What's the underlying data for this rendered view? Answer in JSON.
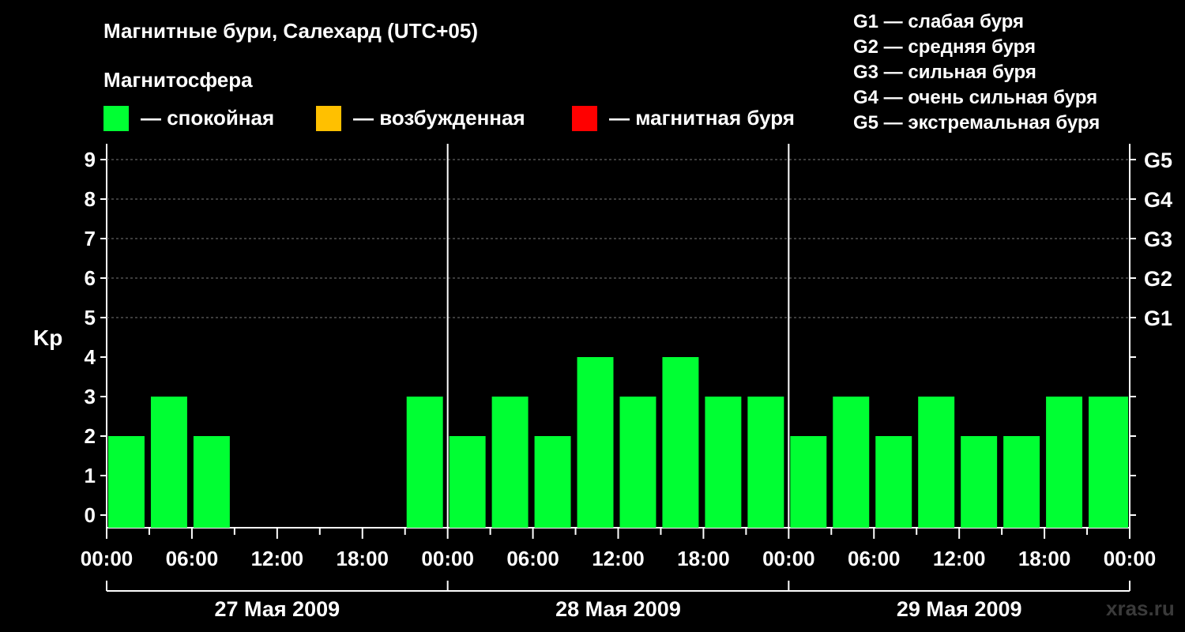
{
  "header": {
    "title": "Магнитные бури, Салехард (UTC+05)",
    "subtitle": "Магнитосфера",
    "watermark": "xras.ru"
  },
  "legend": [
    {
      "label": "— спокойная",
      "color": "#00ff33"
    },
    {
      "label": "— возбужденная",
      "color": "#ffc000"
    },
    {
      "label": "— магнитная буря",
      "color": "#ff0000"
    }
  ],
  "g_scale": [
    "G1 — слабая буря",
    "G2 — средняя буря",
    "G3 — сильная буря",
    "G4 — очень сильная буря",
    "G5 — экстремальная буря"
  ],
  "chart_data": {
    "type": "bar",
    "ylabel": "Kp",
    "ylim": [
      0,
      9
    ],
    "y_ticks": [
      "0",
      "1",
      "2",
      "3",
      "4",
      "5",
      "6",
      "7",
      "8",
      "9"
    ],
    "right_ticks": [
      {
        "y": 5,
        "label": "G1"
      },
      {
        "y": 6,
        "label": "G2"
      },
      {
        "y": 7,
        "label": "G3"
      },
      {
        "y": 8,
        "label": "G4"
      },
      {
        "y": 9,
        "label": "G5"
      }
    ],
    "x_tick_labels": [
      "00:00",
      "06:00",
      "12:00",
      "18:00",
      "00:00",
      "06:00",
      "12:00",
      "18:00",
      "00:00",
      "06:00",
      "12:00",
      "18:00",
      "00:00"
    ],
    "days": [
      "27 Мая 2009",
      "28 Мая 2009",
      "29 Мая 2009"
    ],
    "interval_hours": 3,
    "values": [
      1,
      2,
      1,
      null,
      null,
      null,
      null,
      2,
      1,
      2,
      1,
      3,
      2,
      3,
      2,
      2,
      1,
      2,
      1,
      2,
      1,
      1,
      2,
      2
    ],
    "colors": {
      "calm": "#00ff33"
    },
    "grid": "dashed at Kp 5-9"
  }
}
